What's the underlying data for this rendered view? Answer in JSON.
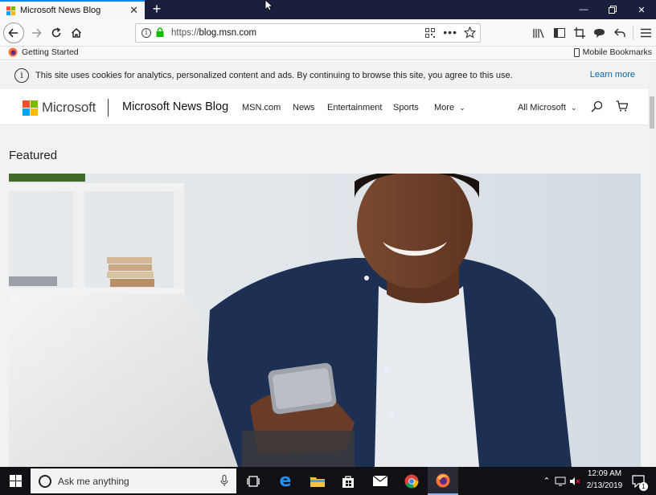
{
  "browser": {
    "tab_title": "Microsoft News Blog",
    "url_prefix": "https://",
    "url_domain": "blog.msn.com",
    "bookmarks": {
      "getting_started": "Getting Started",
      "mobile_bookmarks": "Mobile Bookmarks"
    }
  },
  "cookie_banner": {
    "text": "This site uses cookies for analytics, personalized content and ads. By continuing to browse this site, you agree to this use.",
    "learn_more": "Learn more"
  },
  "site": {
    "logo_text": "Microsoft",
    "blog_title": "Microsoft News Blog",
    "nav": [
      "MSN.com",
      "News",
      "Entertainment",
      "Sports",
      "More"
    ],
    "all_microsoft": "All Microsoft",
    "section_heading": "Featured"
  },
  "taskbar": {
    "search_placeholder": "Ask me anything",
    "time": "12:09 AM",
    "date": "2/13/2019",
    "notification_count": "1"
  },
  "colors": {
    "tabbar": "#1a1f3d",
    "link": "#0067b8",
    "ms_red": "#f25022",
    "ms_green": "#7fba00",
    "ms_blue": "#00a4ef",
    "ms_yellow": "#ffb900",
    "secure_lock": "#12bc00"
  }
}
